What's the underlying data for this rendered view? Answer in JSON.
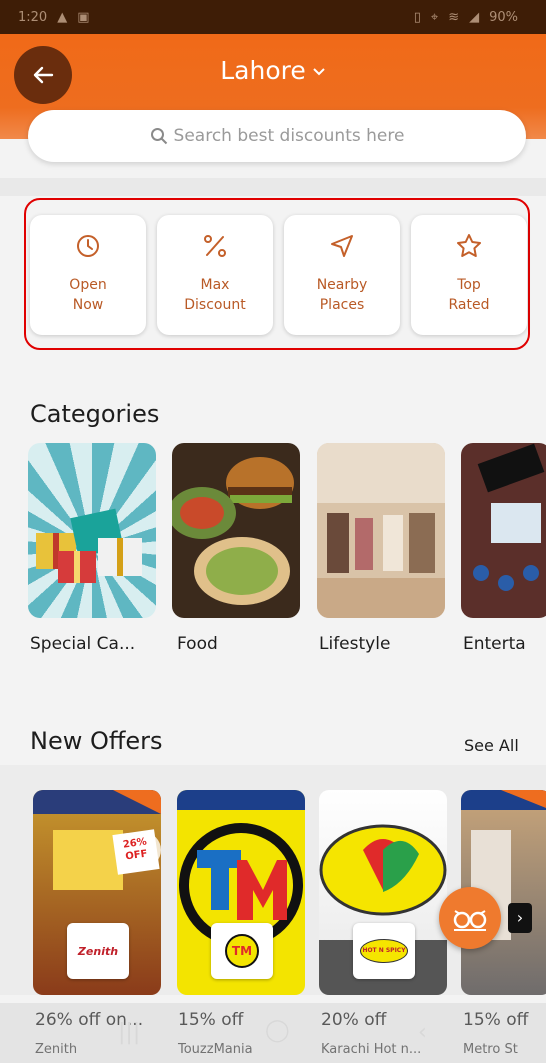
{
  "status_bar": {
    "time": "1:20",
    "battery": "90%"
  },
  "header": {
    "city": "Lahore"
  },
  "search": {
    "placeholder": "Search best discounts here"
  },
  "filters": [
    {
      "label_line1": "Open",
      "label_line2": "Now",
      "icon": "clock-icon"
    },
    {
      "label_line1": "Max",
      "label_line2": "Discount",
      "icon": "percent-icon"
    },
    {
      "label_line1": "Nearby",
      "label_line2": "Places",
      "icon": "navigation-arrow-icon"
    },
    {
      "label_line1": "Top",
      "label_line2": "Rated",
      "icon": "star-icon"
    }
  ],
  "categories": {
    "title": "Categories",
    "items": [
      {
        "label": "Special Ca..."
      },
      {
        "label": "Food"
      },
      {
        "label": "Lifestyle"
      },
      {
        "label": "Enterta"
      }
    ]
  },
  "offers": {
    "title": "New Offers",
    "see_all": "See All",
    "items": [
      {
        "discount": "26% off on...",
        "merchant": "Zenith",
        "logo_text": "Zenith",
        "badge": "26% OFF"
      },
      {
        "discount": "15% off",
        "merchant": "TouzzMania",
        "logo_text": "TM"
      },
      {
        "discount": "20% off",
        "merchant": "Karachi Hot n...",
        "logo_text": "HOT N SPICY"
      },
      {
        "discount": "15% off",
        "merchant": "Metro St"
      }
    ]
  },
  "colors": {
    "brand": "#ee6d1f",
    "highlight": "#e00000"
  }
}
